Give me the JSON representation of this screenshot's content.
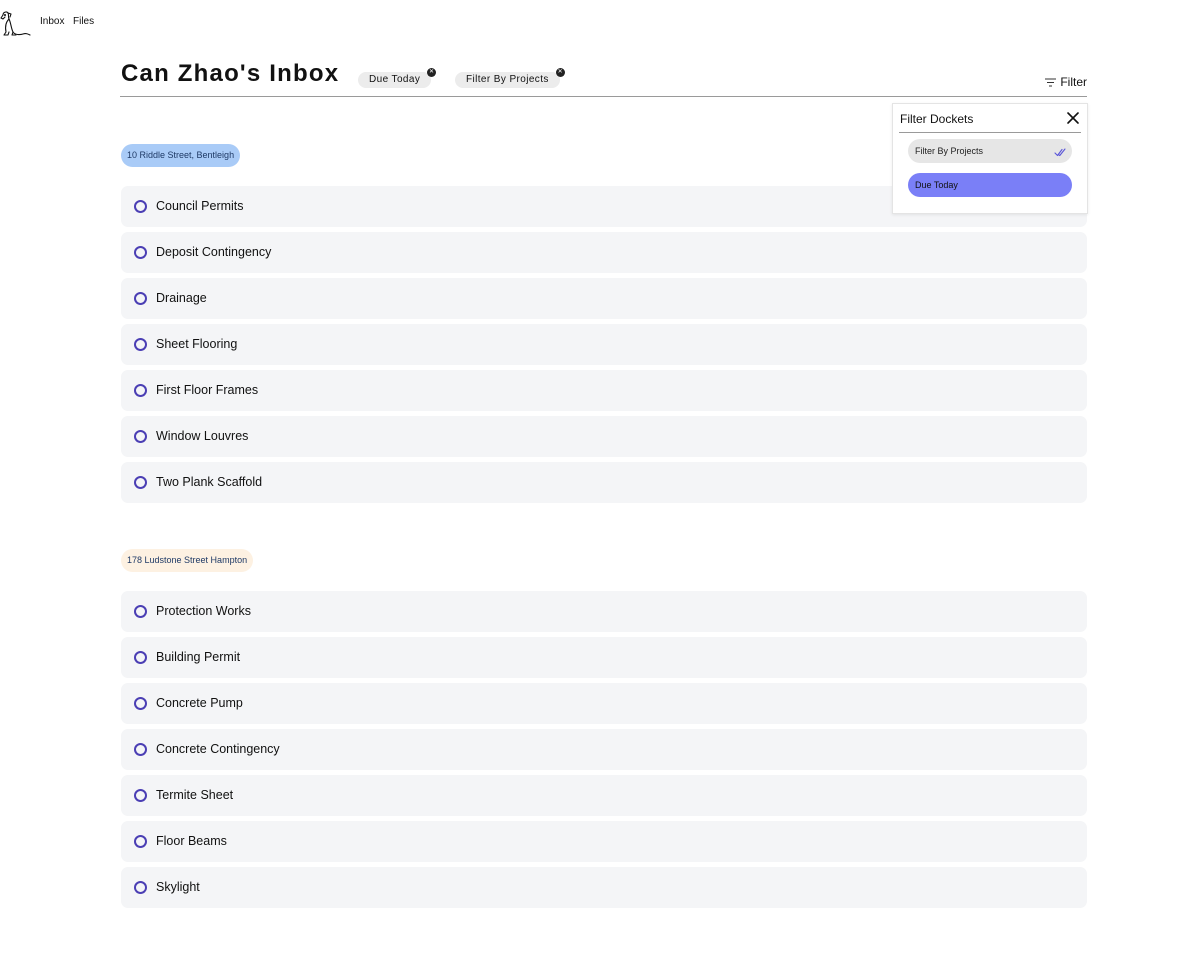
{
  "nav": {
    "inbox": "Inbox",
    "files": "Files"
  },
  "header": {
    "title": "Can Zhao's Inbox",
    "chips": [
      {
        "label": "Due Today"
      },
      {
        "label": "Filter By Projects"
      }
    ],
    "filter_label": "Filter"
  },
  "filter_panel": {
    "title": "Filter Dockets",
    "options": [
      {
        "label": "Filter By Projects",
        "checked": true
      },
      {
        "label": "Due Today",
        "selected": true
      }
    ]
  },
  "projects": [
    {
      "name": "10 Riddle Street, Bentleigh",
      "color": "#a9cbf7",
      "tasks": [
        "Council Permits",
        "Deposit Contingency",
        "Drainage",
        "Sheet Flooring",
        "First Floor Frames",
        "Window Louvres",
        "Two Plank Scaffold"
      ]
    },
    {
      "name": "178 Ludstone Street Hampton",
      "color": "#fdf1e2",
      "tasks": [
        "Protection Works",
        "Building Permit",
        "Concrete Pump",
        "Concrete Contingency",
        "Termite Sheet",
        "Floor Beams",
        "Skylight"
      ]
    }
  ],
  "colors": {
    "accent": "#4b3fb4",
    "selected_option": "#7a7ff7",
    "row_bg": "#f4f5f7"
  }
}
